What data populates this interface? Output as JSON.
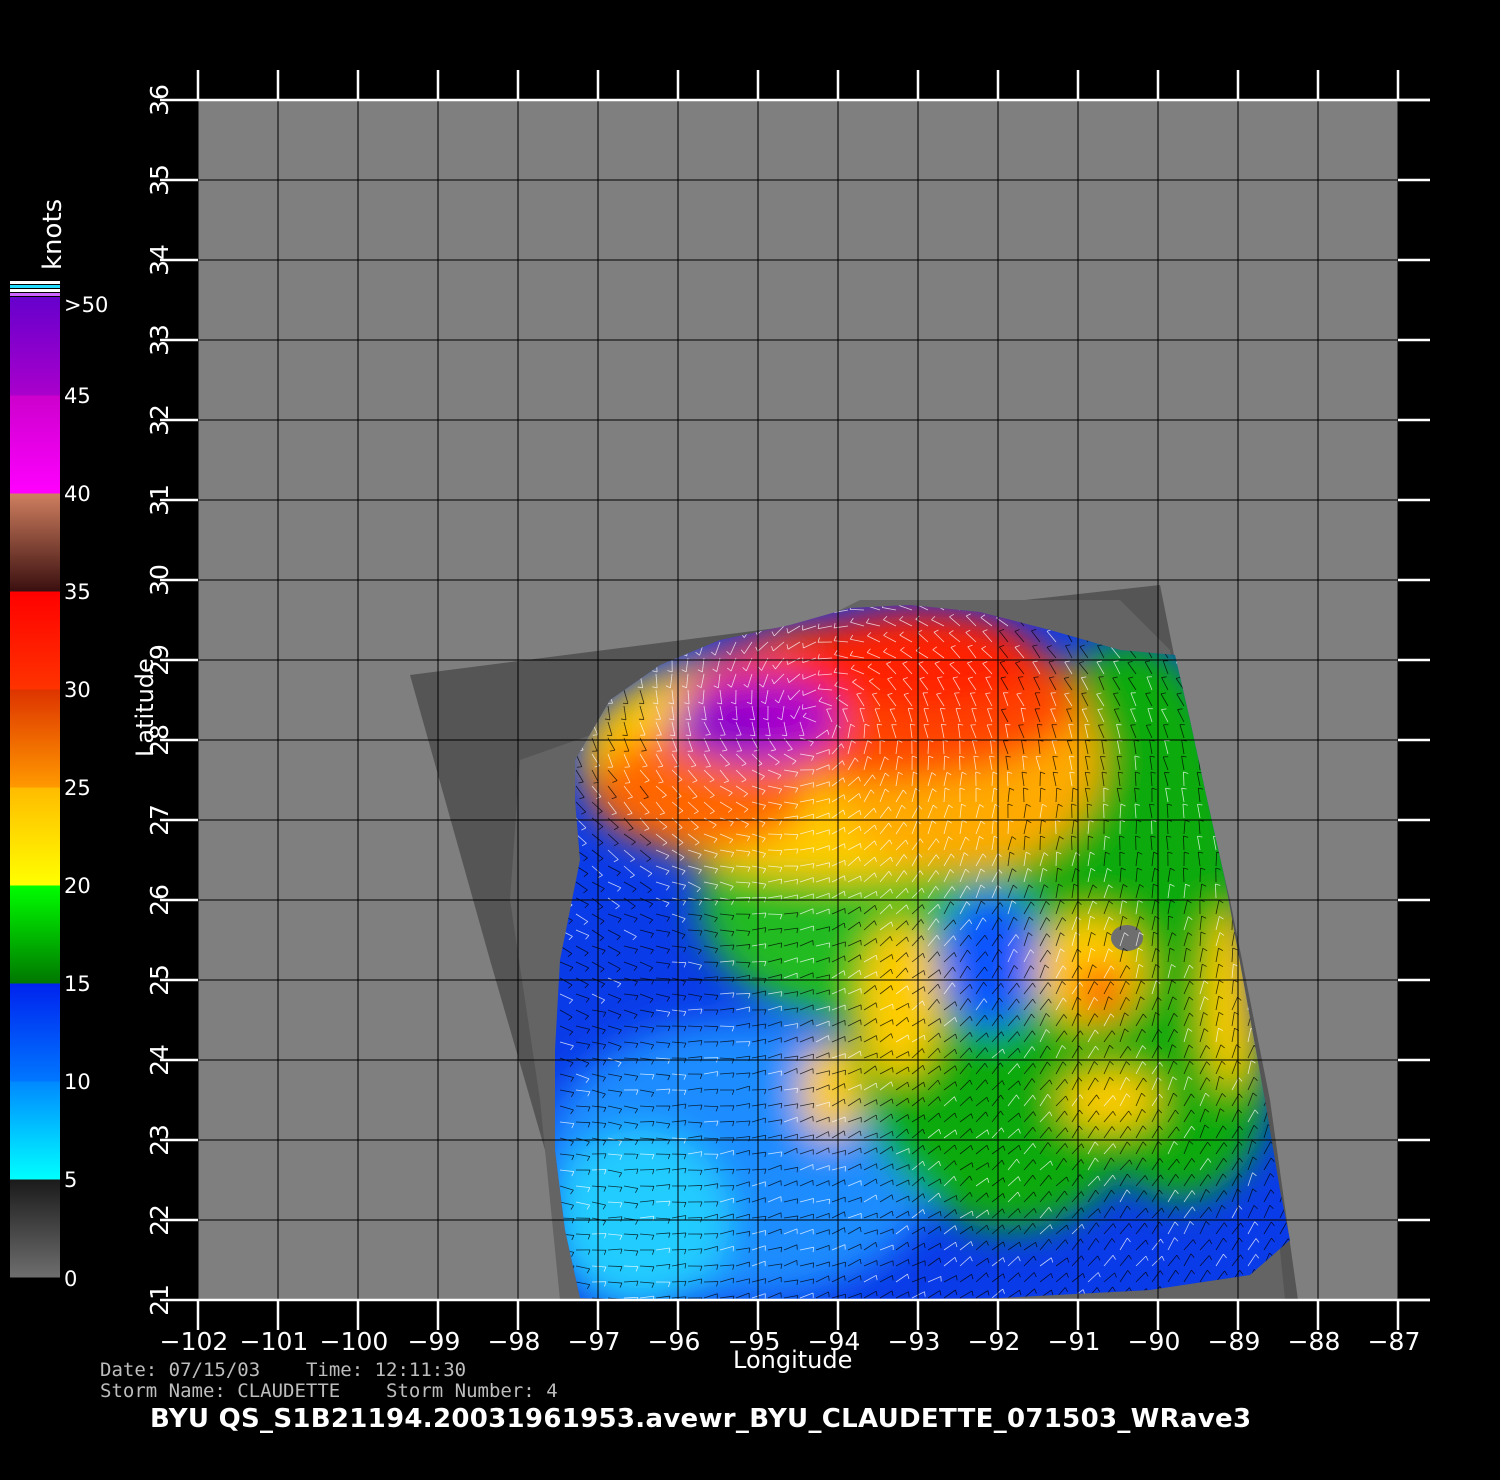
{
  "map": {
    "x_axis": {
      "label": "Longitude",
      "ticks": [
        "-102",
        "-101",
        "-100",
        "-99",
        "-98",
        "-97",
        "-96",
        "-95",
        "-94",
        "-93",
        "-92",
        "-91",
        "-90",
        "-89",
        "-88",
        "-87"
      ],
      "range": [
        -102,
        -87
      ]
    },
    "y_axis": {
      "label": "Latitude",
      "ticks": [
        "21",
        "22",
        "23",
        "24",
        "25",
        "26",
        "27",
        "28",
        "29",
        "30",
        "31",
        "32",
        "33",
        "34",
        "35",
        "36"
      ],
      "range": [
        21,
        36
      ]
    },
    "background_color": "#7f7f7f",
    "grid_color": "#000000",
    "storm_center": {
      "lon": -94.3,
      "lat": 28.2
    }
  },
  "colorbar": {
    "unit": "knots",
    "labels": [
      ">50",
      "45",
      "40",
      "35",
      "30",
      "25",
      "20",
      "15",
      "10",
      "5",
      "0"
    ],
    "bands": [
      {
        "from": 0,
        "to": 5,
        "colors": [
          "#6e6e6e",
          "#1a1a1a"
        ]
      },
      {
        "from": 5,
        "to": 10,
        "colors": [
          "#00ffff",
          "#0088ff"
        ]
      },
      {
        "from": 10,
        "to": 15,
        "colors": [
          "#0077ff",
          "#0022ee"
        ]
      },
      {
        "from": 15,
        "to": 20,
        "colors": [
          "#007700",
          "#00ff00"
        ]
      },
      {
        "from": 20,
        "to": 25,
        "colors": [
          "#ffff00",
          "#ffbb00"
        ]
      },
      {
        "from": 25,
        "to": 30,
        "colors": [
          "#ff9900",
          "#dd3300"
        ]
      },
      {
        "from": 30,
        "to": 35,
        "colors": [
          "#ff3300",
          "#ff0000"
        ]
      },
      {
        "from": 35,
        "to": 40,
        "colors": [
          "#3a0f0f",
          "#d08060"
        ]
      },
      {
        "from": 40,
        "to": 45,
        "colors": [
          "#ff00ff",
          "#cc00cc"
        ]
      },
      {
        "from": 45,
        "to": 50,
        "colors": [
          "#aa00cc",
          "#6600cc"
        ]
      }
    ]
  },
  "footer": {
    "date_label": "Date:",
    "date": "07/15/03",
    "time_label": "Time:",
    "time": "12:11:30",
    "storm_name_label": "Storm  Name:",
    "storm_name": "CLAUDETTE",
    "storm_number_label": "Storm  Number:",
    "storm_number": "4",
    "product": "BYU  QS_S1B21194.20031961953.avewr_BYU_CLAUDETTE_071503_WRave3"
  }
}
